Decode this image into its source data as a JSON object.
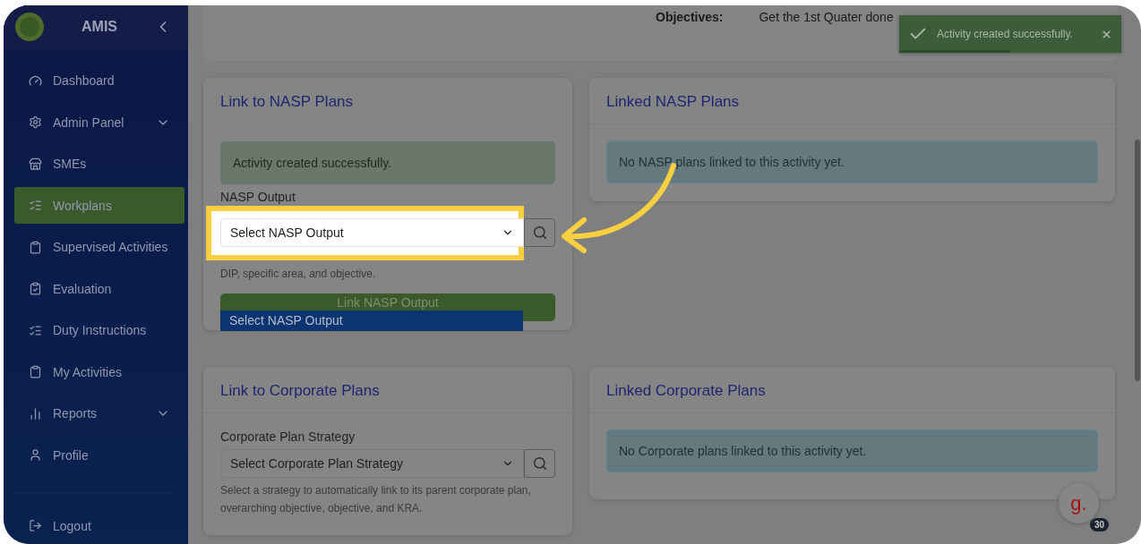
{
  "sidebar": {
    "brand": "AMIS",
    "items": [
      {
        "label": "Dashboard",
        "kind": "link",
        "selected": false
      },
      {
        "label": "Admin Panel",
        "kind": "group",
        "selected": false
      },
      {
        "label": "SMEs",
        "kind": "link",
        "selected": false
      },
      {
        "label": "Workplans",
        "kind": "link",
        "selected": true
      },
      {
        "label": "Supervised Activities",
        "kind": "link",
        "selected": false
      },
      {
        "label": "Evaluation",
        "kind": "link",
        "selected": false
      },
      {
        "label": "Duty Instructions",
        "kind": "link",
        "selected": false
      },
      {
        "label": "My Activities",
        "kind": "link",
        "selected": false
      },
      {
        "label": "Reports",
        "kind": "group",
        "selected": false
      },
      {
        "label": "Profile",
        "kind": "link",
        "selected": false
      }
    ],
    "logout": "Logout"
  },
  "objective": {
    "label": "Objectives:",
    "value": "Get the 1st Quater done"
  },
  "toast": {
    "message": "Activity created successfully.",
    "level": 0.5
  },
  "nasp_card": {
    "title": "Link to NASP Plans",
    "alert": "Activity created successfully.",
    "field_label": "NASP Output",
    "select": {
      "placeholder": "Select NASP Output"
    },
    "help": "DIP, specific area, and objective.",
    "button": "Link NASP Output",
    "options": [
      {
        "label": "Select NASP Output",
        "selected": true
      }
    ]
  },
  "linked_nasp": {
    "title": "Linked NASP Plans",
    "info": "No NASP plans linked to this activity yet."
  },
  "corporate_card": {
    "title": "Link to Corporate Plans",
    "field_label": "Corporate Plan Strategy",
    "select": {
      "placeholder": "Select Corporate Plan Strategy"
    },
    "help": "Select a strategy to automatically link to its parent corporate plan, overarching objective, objective, and KRA."
  },
  "linked_corporate": {
    "title": "Linked Corporate Plans",
    "info": "No Corporate plans linked to this activity yet."
  },
  "help_button": {
    "label": "g.",
    "badge": "30"
  }
}
